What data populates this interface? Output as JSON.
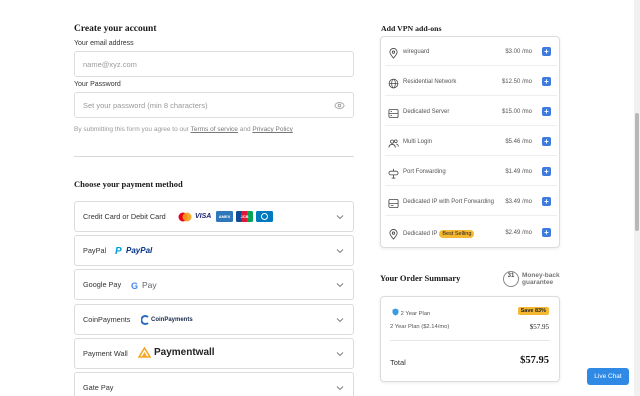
{
  "account": {
    "heading": "Create your account",
    "email_label": "Your email address",
    "email_placeholder": "name@xyz.com",
    "password_label": "Your Password",
    "password_placeholder": "Set your password (min 8 characters)",
    "terms_prefix": "By submitting this form you agree to our",
    "terms_link": "Terms of service",
    "terms_and": "and",
    "privacy_link": "Privacy Policy"
  },
  "payment": {
    "heading": "Choose your payment method",
    "methods": [
      {
        "label": "Credit Card or Debit Card",
        "logos": [
          "VISA",
          "AMEX",
          "JCB"
        ]
      },
      {
        "label": "PayPal",
        "logo_text": "PayPal"
      },
      {
        "label": "Google Pay",
        "logo_text": "Pay"
      },
      {
        "label": "CoinPayments",
        "logo_text": "CoinPayments"
      },
      {
        "label": "Payment Wall",
        "logo_text": "Paymentwall"
      },
      {
        "label": "Gate Pay"
      }
    ]
  },
  "addons": {
    "heading": "Add VPN add-ons",
    "items": [
      {
        "name": "wireguard",
        "price": "$3.00 /mo",
        "icon": "location-pin-icon"
      },
      {
        "name": "Residential Network",
        "price": "$12.50 /mo",
        "icon": "globe-icon"
      },
      {
        "name": "Dedicated Server",
        "price": "$15.00 /mo",
        "icon": "server-icon"
      },
      {
        "name": "Multi Login",
        "price": "$5.46 /mo",
        "icon": "users-icon"
      },
      {
        "name": "Port Forwarding",
        "price": "$1.49 /mo",
        "icon": "port-forwarding-icon"
      },
      {
        "name": "Dedicated IP with Port Forwarding",
        "price": "$3.49 /mo",
        "icon": "ip-server-icon"
      },
      {
        "name": "Dedicated IP",
        "price": "$2.49 /mo",
        "icon": "location-pin-icon",
        "badge": "Best Selling"
      }
    ]
  },
  "summary": {
    "heading": "Your Order Summary",
    "guarantee_days": "31",
    "guarantee_text_1": "Money-back",
    "guarantee_text_2": "guarantee",
    "plan_name": "2 Year Plan",
    "save_badge": "Save 83%",
    "plan_line": "2 Year Plan ($2.14/mo)",
    "plan_price": "$57.95",
    "total_label": "Total",
    "total_value": "$57.95"
  },
  "live_chat": "Live Chat",
  "colors": {
    "accent_blue": "#3d7be0",
    "badge_yellow": "#f5b833",
    "live_chat_blue": "#2f8ae6"
  }
}
